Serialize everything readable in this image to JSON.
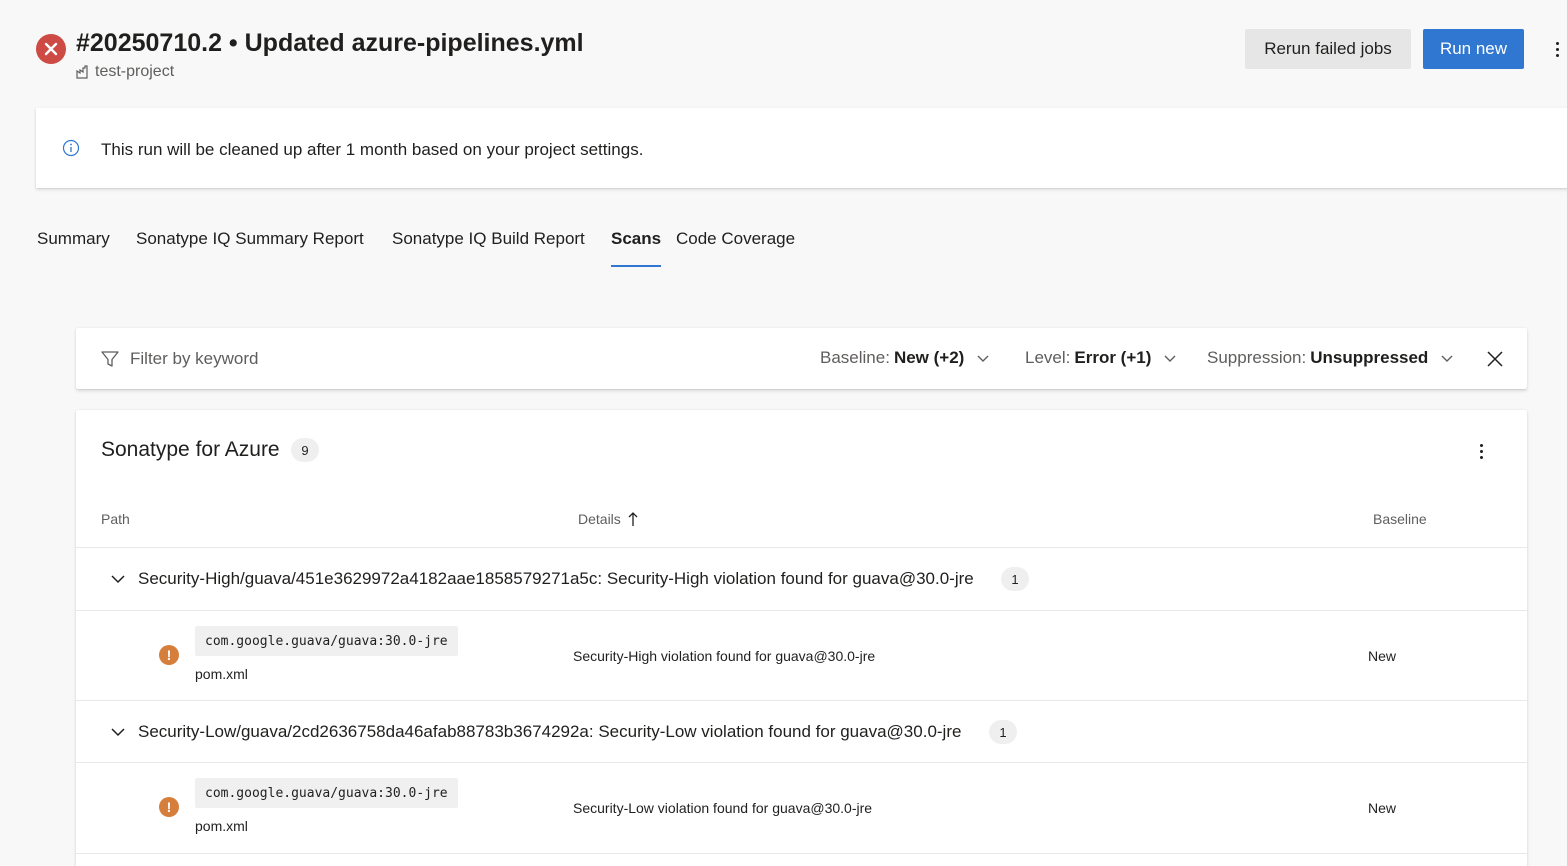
{
  "header": {
    "run_title": "#20250710.2 • Updated azure-pipelines.yml",
    "project": "test-project",
    "rerun_label": "Rerun failed jobs",
    "run_new_label": "Run new",
    "status": "failed",
    "status_color": "#cd4a45",
    "accent_color": "#2f77d1"
  },
  "banner": {
    "text": "This run will be cleaned up after 1 month based on your project settings."
  },
  "tabs": [
    {
      "label": "Summary",
      "active": false
    },
    {
      "label": "Sonatype IQ Summary Report",
      "active": false
    },
    {
      "label": "Sonatype IQ Build Report",
      "active": false
    },
    {
      "label": "Scans",
      "active": true
    },
    {
      "label": "Code Coverage",
      "active": false
    }
  ],
  "filter": {
    "placeholder": "Filter by keyword",
    "baseline_key": "Baseline:",
    "baseline_value": "New (+2)",
    "level_key": "Level:",
    "level_value": "Error (+1)",
    "suppression_key": "Suppression:",
    "suppression_value": "Unsuppressed"
  },
  "results": {
    "tool_name": "Sonatype for Azure",
    "count": "9",
    "columns": {
      "path": "Path",
      "details": "Details",
      "baseline": "Baseline"
    },
    "groups": [
      {
        "title": "Security-High/guava/451e3629972a4182aae1858579271a5c: Security-High violation found for guava@30.0-jre",
        "count": "1",
        "rows": [
          {
            "artifact": "com.google.guava/guava:30.0-jre",
            "file": "pom.xml",
            "details": "Security-High violation found for guava@30.0-jre",
            "baseline": "New"
          }
        ]
      },
      {
        "title": "Security-Low/guava/2cd2636758da46afab88783b3674292a: Security-Low violation found for guava@30.0-jre",
        "count": "1",
        "rows": [
          {
            "artifact": "com.google.guava/guava:30.0-jre",
            "file": "pom.xml",
            "details": "Security-Low violation found for guava@30.0-jre",
            "baseline": "New"
          }
        ]
      }
    ]
  },
  "icons": {
    "status": "error-x-icon",
    "project": "project-building-icon",
    "banner": "info-icon",
    "filter": "funnel-filter-icon",
    "dropdown": "chevron-down-icon",
    "clear": "close-icon",
    "group_toggle": "chevron-down-icon",
    "result_level": "warning-icon",
    "sort": "sort-ascending-icon",
    "more": "more-vertical-icon"
  },
  "colors": {
    "warning": "#d67f3c"
  }
}
